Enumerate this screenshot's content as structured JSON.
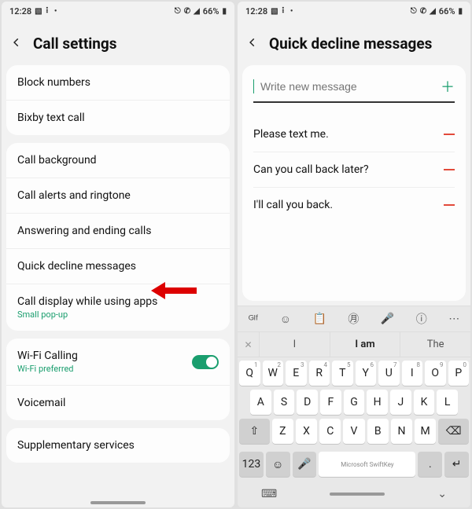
{
  "status": {
    "time": "12:28",
    "battery": "66%"
  },
  "left_screen": {
    "title": "Call settings",
    "group1": [
      {
        "label": "Block numbers"
      },
      {
        "label": "Bixby text call"
      }
    ],
    "group2": [
      {
        "label": "Call background"
      },
      {
        "label": "Call alerts and ringtone"
      },
      {
        "label": "Answering and ending calls"
      },
      {
        "label": "Quick decline messages"
      },
      {
        "label": "Call display while using apps",
        "sub": "Small pop-up"
      }
    ],
    "group3": [
      {
        "label": "Wi-Fi Calling",
        "sub": "Wi-Fi preferred",
        "toggle": true
      },
      {
        "label": "Voicemail"
      }
    ],
    "group4": [
      {
        "label": "Supplementary services"
      }
    ]
  },
  "right_screen": {
    "title": "Quick decline messages",
    "input_placeholder": "Write new message",
    "messages": [
      "Please text me.",
      "Can you call back later?",
      "I'll call you back."
    ],
    "suggestions": {
      "left": "I",
      "mid": "I am",
      "right": "The"
    },
    "keyboard": {
      "row1": [
        {
          "k": "Q",
          "n": "1"
        },
        {
          "k": "W",
          "n": "2"
        },
        {
          "k": "E",
          "n": "3"
        },
        {
          "k": "R",
          "n": "4"
        },
        {
          "k": "T",
          "n": "5"
        },
        {
          "k": "Y",
          "n": "6"
        },
        {
          "k": "U",
          "n": "7"
        },
        {
          "k": "I",
          "n": "8"
        },
        {
          "k": "O",
          "n": "9"
        },
        {
          "k": "P",
          "n": "0"
        }
      ],
      "row2": [
        "A",
        "S",
        "D",
        "F",
        "G",
        "H",
        "J",
        "K",
        "L"
      ],
      "row3": [
        "Z",
        "X",
        "C",
        "V",
        "B",
        "N",
        "M"
      ],
      "numkey": "123",
      "space_label": "Microsoft SwiftKey",
      "period": "."
    }
  }
}
